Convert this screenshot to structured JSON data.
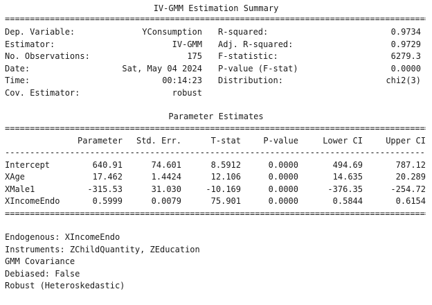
{
  "summary": {
    "title": "IV-GMM Estimation Summary",
    "rows": [
      {
        "label_l": "Dep. Variable:",
        "value_l": "YConsumption",
        "label_r": "R-squared:",
        "value_r": "0.9734"
      },
      {
        "label_l": "Estimator:",
        "value_l": "IV-GMM",
        "label_r": "Adj. R-squared:",
        "value_r": "0.9729"
      },
      {
        "label_l": "No. Observations:",
        "value_l": "175",
        "label_r": "F-statistic:",
        "value_r": "6279.3"
      },
      {
        "label_l": "Date:",
        "value_l": "Sat, May 04 2024",
        "label_r": "P-value (F-stat)",
        "value_r": "0.0000"
      },
      {
        "label_l": "Time:",
        "value_l": "00:14:23",
        "label_r": "Distribution:",
        "value_r": "chi2(3)"
      },
      {
        "label_l": "Cov. Estimator:",
        "value_l": "robust",
        "label_r": "",
        "value_r": ""
      }
    ]
  },
  "params": {
    "title": "Parameter Estimates",
    "headers": [
      "Parameter",
      "Std. Err.",
      "T-stat",
      "P-value",
      "Lower CI",
      "Upper CI"
    ],
    "rows": [
      {
        "name": "Intercept",
        "vals": [
          "640.91",
          "74.601",
          "8.5912",
          "0.0000",
          "494.69",
          "787.12"
        ]
      },
      {
        "name": "XAge",
        "vals": [
          "17.462",
          "1.4424",
          "12.106",
          "0.0000",
          "14.635",
          "20.289"
        ]
      },
      {
        "name": "XMale1",
        "vals": [
          "-315.53",
          "31.030",
          "-10.169",
          "0.0000",
          "-376.35",
          "-254.72"
        ]
      },
      {
        "name": "XIncomeEndo",
        "vals": [
          "0.5999",
          "0.0079",
          "75.901",
          "0.0000",
          "0.5844",
          "0.6154"
        ]
      }
    ]
  },
  "footer": [
    "Endogenous: XIncomeEndo",
    "Instruments: ZChildQuantity, ZEducation",
    "GMM Covariance",
    "Debiased: False",
    "Robust (Heteroskedastic)"
  ],
  "rules": {
    "double": "====================================================================================================",
    "single": "----------------------------------------------------------------------------------------------------"
  }
}
